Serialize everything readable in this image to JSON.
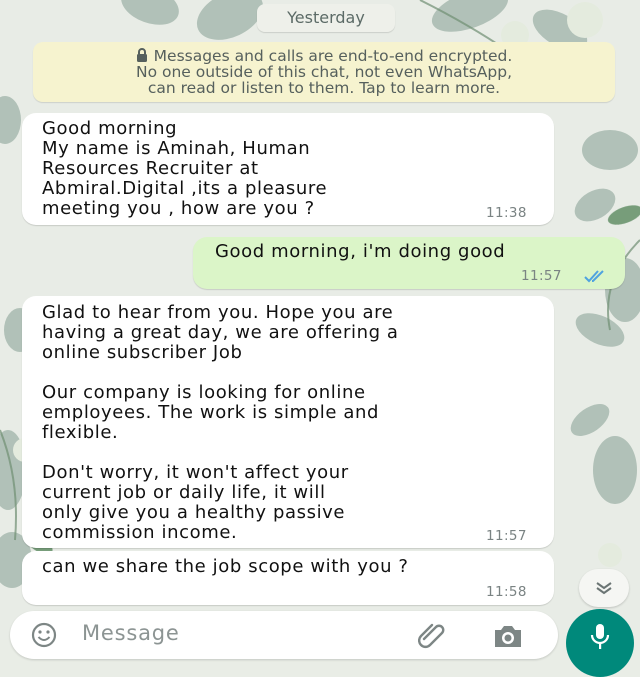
{
  "chat": {
    "date_label": "Yesterday",
    "encryption_notice": [
      "Messages and calls are end-to-end encrypted.",
      "No one outside of this chat, not even WhatsApp,",
      "can read or listen to them. Tap to learn more."
    ],
    "messages": [
      {
        "direction": "incoming",
        "text": "Good morning\nMy name is Aminah, Human\nResources Recruiter at\nAbmiral.Digital ,its a pleasure\nmeeting you , how are you ?",
        "time": "11:38"
      },
      {
        "direction": "outgoing",
        "text": "Good morning, i'm doing good",
        "time": "11:57",
        "status": "read"
      },
      {
        "direction": "incoming",
        "text": "Glad to hear from you. Hope you are\nhaving a great day, we are offering a\nonline subscriber Job\n\nOur company is looking for online\nemployees. The work is simple and\nflexible.\n\nDon't worry, it won't affect your\ncurrent job or daily life, it will\nonly give you a healthy passive\ncommission income.",
        "time": "11:57"
      },
      {
        "direction": "incoming",
        "text": "can we share the job scope with you ?",
        "time": "11:58"
      }
    ]
  },
  "composer": {
    "placeholder": "Message",
    "icons": {
      "emoji": "emoji-icon",
      "attach": "paperclip-icon",
      "camera": "camera-icon",
      "mic": "mic-icon",
      "scroll": "double-chevron-down-icon"
    }
  },
  "colors": {
    "incoming_bubble": "#ffffff",
    "outgoing_bubble": "#dbf5c8",
    "encryption_bg": "#f6f3cf",
    "accent": "#00897b",
    "read_ticks": "#4fa3e0"
  }
}
